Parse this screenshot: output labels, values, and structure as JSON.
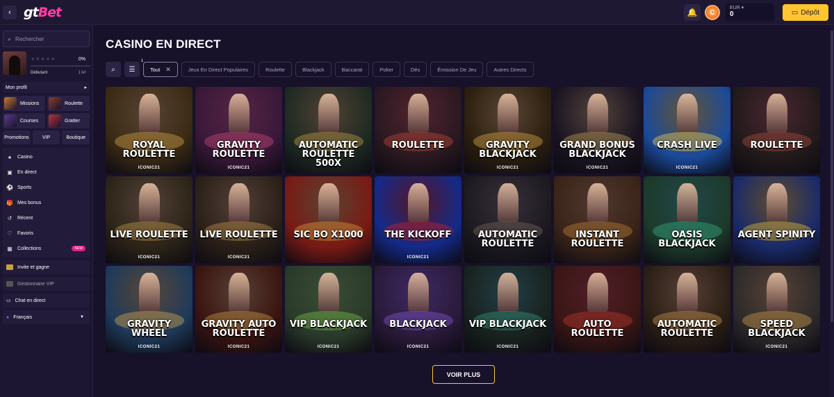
{
  "header": {
    "logo_gt": "gt",
    "logo_bet": "Bet",
    "currency": "EUR ▾",
    "balance": "0",
    "deposit_label": "Dépôt"
  },
  "sidebar": {
    "search_placeholder": "Rechercher",
    "profile": {
      "progress": "0%",
      "level_name": "Débutant",
      "level_num": "1 lvl",
      "progress_value": 0
    },
    "mon_profil": "Mon profil",
    "tiles": [
      {
        "label": "Missions",
        "color": "#c97a2a"
      },
      {
        "label": "Roulette",
        "color": "#8b3c2a"
      },
      {
        "label": "Courses",
        "color": "#5a3b8a"
      },
      {
        "label": "Gratter",
        "color": "#b8323a"
      }
    ],
    "tri": [
      "Promotions",
      "VIP",
      "Boutique"
    ],
    "nav": [
      {
        "label": "Casino",
        "icon": "♠"
      },
      {
        "label": "En direct",
        "icon": "▣"
      },
      {
        "label": "Sports",
        "icon": "⚽"
      },
      {
        "label": "Mes bonus",
        "icon": "🎁"
      },
      {
        "label": "Récent",
        "icon": "↺"
      },
      {
        "label": "Favoris",
        "icon": "♡"
      },
      {
        "label": "Collections",
        "icon": "▦",
        "badge": "NEW"
      }
    ],
    "invite": "Invite et gagne",
    "vip_manager": "Gestionnaire VIP",
    "chat": "Chat en direct",
    "language": "Français"
  },
  "main": {
    "title": "CASINO EN DIRECT",
    "filter_count": "1",
    "filters": [
      {
        "label": "Tout",
        "active": true
      },
      {
        "label": "Jeux En Direct Populaires"
      },
      {
        "label": "Roulette"
      },
      {
        "label": "Blackjack"
      },
      {
        "label": "Baccarat"
      },
      {
        "label": "Poker"
      },
      {
        "label": "Dés"
      },
      {
        "label": "Émission De Jeu"
      },
      {
        "label": "Autres Directs"
      }
    ],
    "games": [
      {
        "title": "Royal Roulette",
        "provider": "ICONIC21",
        "bg": "#3a2a14",
        "accent": "#d9a94a"
      },
      {
        "title": "Gravity Roulette",
        "provider": "ICONIC21",
        "bg": "#3a1838",
        "accent": "#d14b7c"
      },
      {
        "title": "Automatic Roulette 500X",
        "provider": "",
        "bg": "#1e2a22",
        "accent": "#c8a24a"
      },
      {
        "title": "Roulette",
        "provider": "",
        "bg": "#2a1820",
        "accent": "#c64a3a"
      },
      {
        "title": "Gravity Blackjack",
        "provider": "ICONIC21",
        "bg": "#2a1e0e",
        "accent": "#e3b04a"
      },
      {
        "title": "Grand Bonus Blackjack",
        "provider": "ICONIC21",
        "bg": "#1a1422",
        "accent": "#c9a85a"
      },
      {
        "title": "Crash Live",
        "provider": "ICONIC21",
        "bg": "#1a4a9a",
        "accent": "#ffd845"
      },
      {
        "title": "Roulette",
        "provider": "",
        "bg": "#221a1a",
        "accent": "#b05040"
      },
      {
        "title": "Live Roulette",
        "provider": "ICONIC21",
        "bg": "#2c2418",
        "accent": "#c9a050"
      },
      {
        "title": "Live Roulette",
        "provider": "ICONIC21",
        "bg": "#2a2018",
        "accent": "#c89b50"
      },
      {
        "title": "Sic Bo x1000",
        "provider": "",
        "bg": "#7a1a14",
        "accent": "#e2a640"
      },
      {
        "title": "The Kickoff",
        "provider": "ICONIC21",
        "bg": "#142a8a",
        "accent": "#d3201e"
      },
      {
        "title": "Automatic Roulette",
        "provider": "",
        "bg": "#1c1a20",
        "accent": "#7a6a5a"
      },
      {
        "title": "Instant Roulette",
        "provider": "",
        "bg": "#3a2418",
        "accent": "#c0843a"
      },
      {
        "title": "Oasis Blackjack",
        "provider": "",
        "bg": "#1c3a2a",
        "accent": "#39b58a"
      },
      {
        "title": "Agent Spinity",
        "provider": "",
        "bg": "#1a2a6a",
        "accent": "#f2c530"
      },
      {
        "title": "Gravity Wheel",
        "provider": "ICONIC21",
        "bg": "#1e3a5a",
        "accent": "#e0b050"
      },
      {
        "title": "Gravity Auto Roulette",
        "provider": "ICONIC21",
        "bg": "#3a1410",
        "accent": "#d4a14a"
      },
      {
        "title": "VIP Blackjack",
        "provider": "ICONIC21",
        "bg": "#2a3a2a",
        "accent": "#7fc64a"
      },
      {
        "title": "Blackjack",
        "provider": "ICONIC21",
        "bg": "#2a1a3a",
        "accent": "#8a5ad6"
      },
      {
        "title": "VIP Blackjack",
        "provider": "ICONIC21",
        "bg": "#18221e",
        "accent": "#3a9a80"
      },
      {
        "title": "Auto Roulette",
        "provider": "",
        "bg": "#3a1614",
        "accent": "#c23a2a"
      },
      {
        "title": "Automatic Roulette",
        "provider": "",
        "bg": "#2a1e14",
        "accent": "#d29c50"
      },
      {
        "title": "Speed Blackjack",
        "provider": "ICONIC21",
        "bg": "#2c2a2a",
        "accent": "#d8a24a"
      }
    ],
    "voir_plus": "VOIR PLUS"
  }
}
